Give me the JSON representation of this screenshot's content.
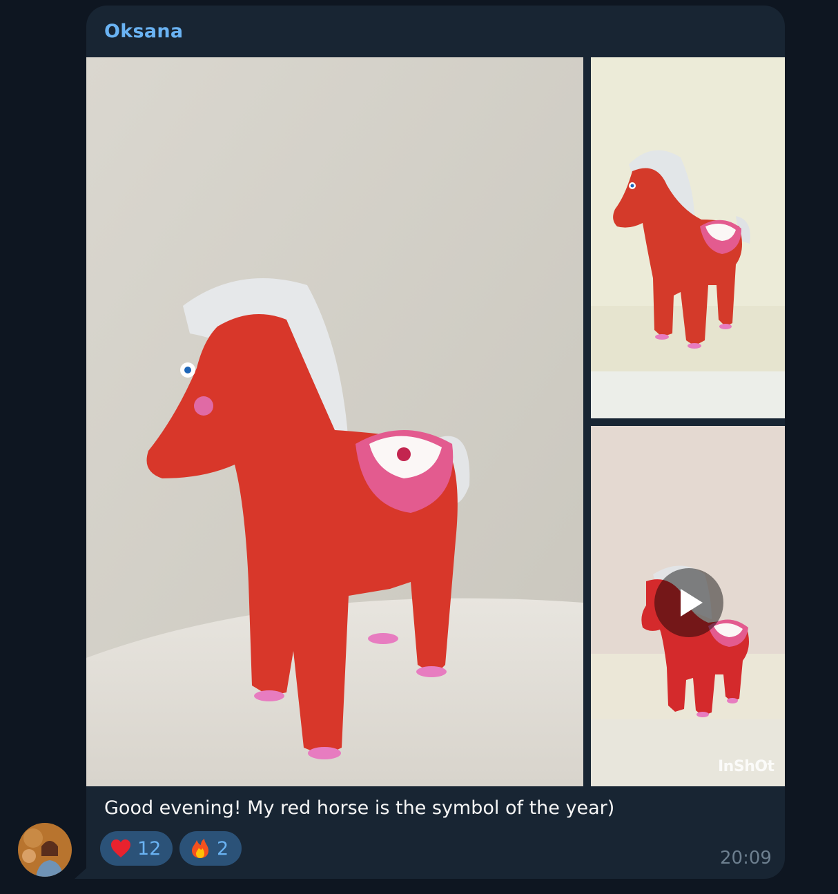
{
  "chat": {
    "sender_name": "Oksana",
    "caption": "Goo​d evening! My red horse is the symbol of the year)",
    "time": "20:09",
    "reactions": [
      {
        "emoji": "heart-icon",
        "count": "12"
      },
      {
        "emoji": "fire-icon",
        "count": "2"
      }
    ]
  },
  "media": {
    "video_watermark": "InShOt"
  },
  "colors": {
    "background": "#0e1621",
    "bubble": "#182533",
    "sender_name": "#6ab3f3",
    "reaction_pill": "#2b5278",
    "timestamp": "#6d7f8f"
  }
}
